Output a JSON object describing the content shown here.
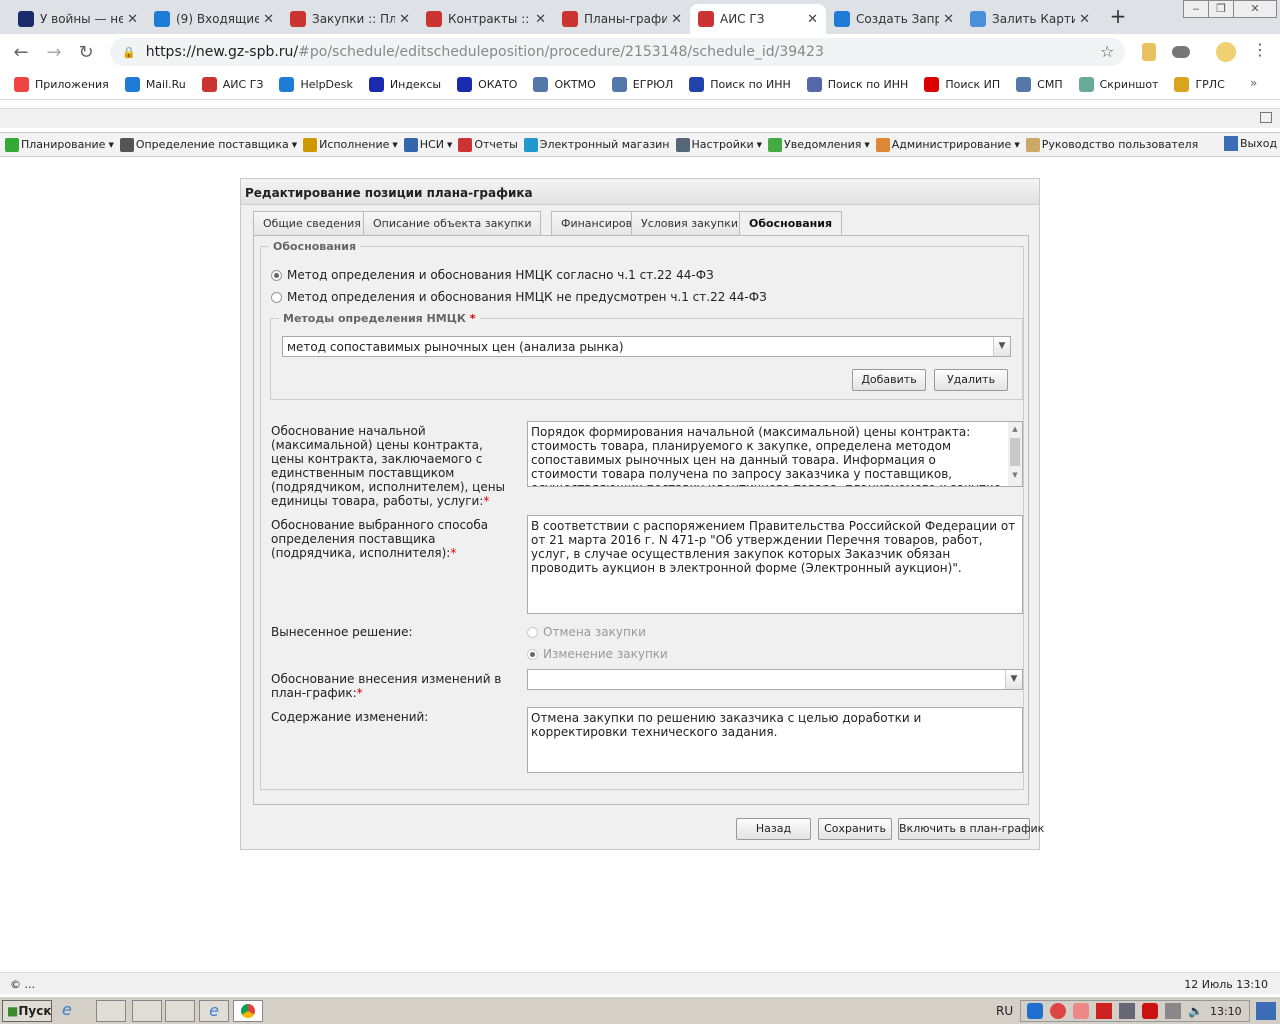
{
  "browser": {
    "tabs": [
      {
        "title": "У войны — не",
        "icon": "vk-icon",
        "color": "#1a2b6d"
      },
      {
        "title": "(9) Входящие",
        "icon": "mail-icon",
        "color": "#1e7bd6"
      },
      {
        "title": "Закупки :: Пла",
        "icon": "ais-gz-icon",
        "color": "#c33"
      },
      {
        "title": "Контракты :: ",
        "icon": "ais-gz-icon",
        "color": "#c33"
      },
      {
        "title": "Планы-графи",
        "icon": "ais-gz-icon",
        "color": "#c33"
      },
      {
        "title": "АИС ГЗ",
        "icon": "ais-gz-icon",
        "color": "#c33",
        "active": true
      },
      {
        "title": "Создать Запр",
        "icon": "helpdesk-icon",
        "color": "#1e7bd6"
      },
      {
        "title": "Залить Карти",
        "icon": "image-icon",
        "color": "#4a90d9"
      }
    ],
    "url_host": "https://new.gz-spb.ru/",
    "url_path": "#po/schedule/editscheduleposition/procedure/2153148/schedule_id/39423",
    "bookmarks": [
      {
        "label": "Приложения",
        "icon": "apps-icon",
        "color": "#e44"
      },
      {
        "label": "Mail.Ru",
        "icon": "mail-icon",
        "color": "#1e7bd6"
      },
      {
        "label": "АИС ГЗ",
        "icon": "ais-gz-icon",
        "color": "#c33"
      },
      {
        "label": "HelpDesk",
        "icon": "helpdesk-icon",
        "color": "#1e7bd6"
      },
      {
        "label": "Индексы",
        "icon": "star-icon",
        "color": "#1a2bb0"
      },
      {
        "label": "ОКАТО",
        "icon": "star-icon",
        "color": "#1a2bb0"
      },
      {
        "label": "ОКТМО",
        "icon": "emblem-icon",
        "color": "#5577aa"
      },
      {
        "label": "ЕГРЮЛ",
        "icon": "emblem-icon",
        "color": "#5577aa"
      },
      {
        "label": "Поиск по ИНН",
        "icon": "listorg-icon",
        "color": "#2244aa"
      },
      {
        "label": "Поиск по ИНН",
        "icon": "igk-icon",
        "color": "#5566aa"
      },
      {
        "label": "Поиск ИП",
        "icon": "ip-icon",
        "color": "#d00"
      },
      {
        "label": "СМП",
        "icon": "emblem-icon",
        "color": "#5577aa"
      },
      {
        "label": "Скриншот",
        "icon": "screenshot-icon",
        "color": "#6a9"
      },
      {
        "label": "ГРЛС",
        "icon": "grls-icon",
        "color": "#d9a520"
      }
    ]
  },
  "appmenu": [
    {
      "label": "Планирование",
      "dropdown": true,
      "color": "#3a3"
    },
    {
      "label": "Определение поставщика",
      "dropdown": true,
      "color": "#555"
    },
    {
      "label": "Исполнение",
      "dropdown": true,
      "color": "#c90"
    },
    {
      "label": "НСИ",
      "dropdown": true,
      "color": "#36a"
    },
    {
      "label": "Отчеты",
      "dropdown": false,
      "color": "#c33"
    },
    {
      "label": "Электронный магазин",
      "dropdown": false,
      "color": "#29c"
    },
    {
      "label": "Настройки",
      "dropdown": true,
      "color": "#567"
    },
    {
      "label": "Уведомления",
      "dropdown": true,
      "color": "#4a4"
    },
    {
      "label": "Администрирование",
      "dropdown": true,
      "color": "#d83"
    },
    {
      "label": "Руководство пользователя",
      "dropdown": false,
      "color": "#ca6"
    }
  ],
  "logout": "Выход",
  "form": {
    "title": "Редактирование позиции плана-графика",
    "tabs": [
      "Общие сведения",
      "Описание объекта закупки",
      "Финансирование",
      "Условия закупки",
      "Обоснования"
    ],
    "active_tab": "Обоснования",
    "fieldset_legend": "Обоснования",
    "nmck_radio": [
      {
        "label": "Метод определения и обоснования НМЦК согласно ч.1 ст.22 44-ФЗ",
        "checked": true
      },
      {
        "label": "Метод определения и обоснования НМЦК не предусмотрен ч.1 ст.22 44-ФЗ",
        "checked": false
      }
    ],
    "methods_legend": "Методы определения НМЦК",
    "methods_value": "метод сопоставимых рыночных цен (анализа рынка)",
    "add_label": "Добавить",
    "delete_label": "Удалить",
    "price_label": "Обоснование начальной (максимальной) цены контракта, цены контракта, заключаемого с единственным поставщиком (подрядчиком, исполнителем), цены единицы товара, работы, услуги:",
    "price_value": "Порядок формирования начальной (максимальной) цены контракта: стоимость товара, планируемого к закупке, определена методом сопоставимых рыночных цен на данный товара. Информация о стоимости товара получена по запросу заказчика у поставщиков, осуществляющих поставку идентичного товара, планируемого к закупке",
    "method_label": "Обоснование выбранного способа определения поставщика (подрядчика, исполнителя):",
    "method_value": "В соответствии с распоряжением Правительства Российской Федерации от от 21 марта 2016 г. N 471-р \"Об утверждении Перечня товаров, работ, услуг, в случае осуществления закупок которых Заказчик обязан проводить аукцион в электронной форме (Электронный аукцион)\".",
    "decision_label": "Вынесенное решение:",
    "decision_options": [
      {
        "label": "Отмена закупки",
        "checked": false
      },
      {
        "label": "Изменение закупки",
        "checked": true
      }
    ],
    "change_reason_label": "Обоснование внесения изменений в план-график:",
    "change_reason_value": "",
    "change_content_label": "Содержание изменений:",
    "change_content_value": "Отмена закупки по решению заказчика с целью доработки и корректировки технического задания.",
    "required_mark": "*",
    "back_label": "Назад",
    "save_label": "Сохранить",
    "include_label": "Включить в план-график"
  },
  "status": {
    "left": "© ...",
    "right": "12 Июль 13:10"
  },
  "taskbar": {
    "start": "Пуск",
    "lang": "RU",
    "clock": "13:10"
  }
}
